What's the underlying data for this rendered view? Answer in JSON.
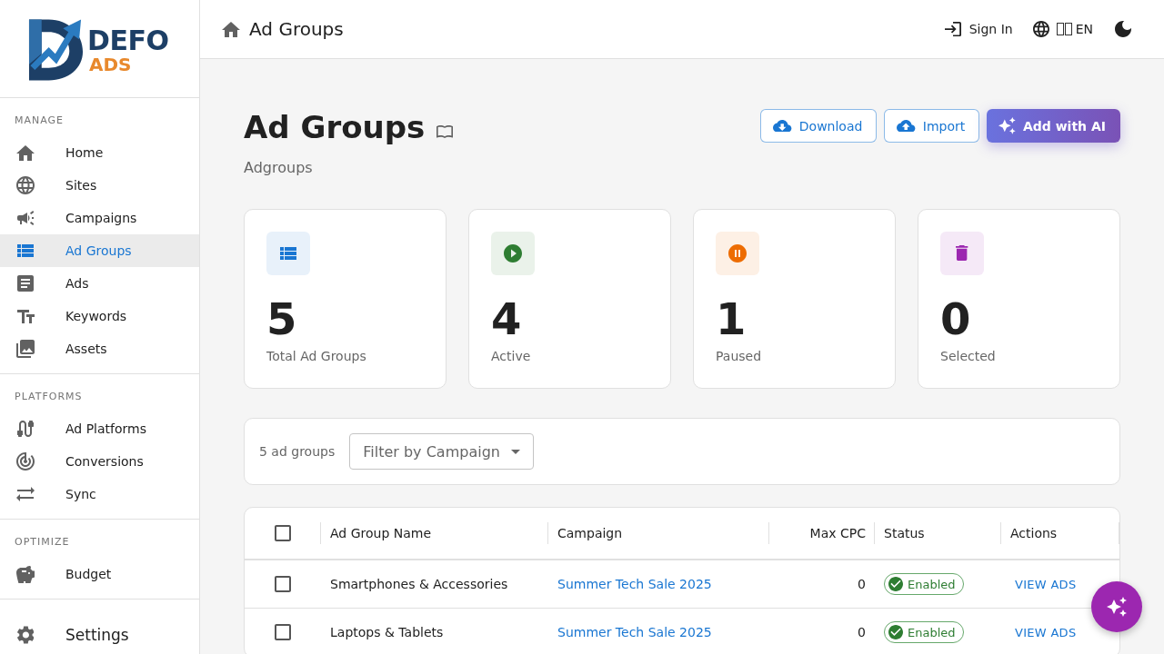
{
  "sidebar": {
    "logo": {
      "name": "DEFO",
      "tagline": "ADS"
    },
    "sections": [
      {
        "label": "MANAGE",
        "items": [
          {
            "label": "Home",
            "selected": false
          },
          {
            "label": "Sites",
            "selected": false
          },
          {
            "label": "Campaigns",
            "selected": false
          },
          {
            "label": "Ad Groups",
            "selected": true
          },
          {
            "label": "Ads",
            "selected": false
          },
          {
            "label": "Keywords",
            "selected": false
          },
          {
            "label": "Assets",
            "selected": false
          }
        ]
      },
      {
        "label": "PLATFORMS",
        "items": [
          {
            "label": "Ad Platforms",
            "selected": false
          },
          {
            "label": "Conversions",
            "selected": false
          },
          {
            "label": "Sync",
            "selected": false
          }
        ]
      },
      {
        "label": "OPTIMIZE",
        "items": [
          {
            "label": "Budget",
            "selected": false
          }
        ]
      }
    ],
    "settings": {
      "label": "Settings",
      "selected": false
    }
  },
  "header": {
    "breadcrumb": "Ad Groups",
    "sign_in": "Sign In",
    "language": "EN"
  },
  "page": {
    "title": "Ad Groups",
    "subtitle": "Adgroups",
    "actions": [
      {
        "label": "Download",
        "kind": "download"
      },
      {
        "label": "Import",
        "kind": "import"
      },
      {
        "label": "Add with AI",
        "kind": "ai"
      }
    ]
  },
  "stats": [
    {
      "value": "5",
      "label": "Total Ad Groups",
      "kind": "total",
      "color": "#1976d2"
    },
    {
      "value": "4",
      "label": "Active",
      "kind": "active",
      "color": "#2e7d32"
    },
    {
      "value": "1",
      "label": "Paused",
      "kind": "paused",
      "color": "#ed6c02"
    },
    {
      "value": "0",
      "label": "Selected",
      "kind": "selected",
      "color": "#9c27b0"
    }
  ],
  "filter_bar": {
    "count": "5 ad groups",
    "campaign_filter": {
      "placeholder": "Filter by Campaign"
    }
  },
  "table": {
    "select_all": {
      "checked": false
    },
    "columns": [
      "Ad Group Name",
      "Campaign",
      "Max CPC",
      "Status",
      "Actions"
    ],
    "rows": [
      {
        "checked": false,
        "name": "Smartphones & Accessories",
        "campaign": "Summer Tech Sale 2025",
        "max_cpc": "0",
        "status": {
          "label": "Enabled",
          "kind": "enabled"
        },
        "action": "VIEW ADS"
      },
      {
        "checked": false,
        "name": "Laptops & Tablets",
        "campaign": "Summer Tech Sale 2025",
        "max_cpc": "0",
        "status": {
          "label": "Enabled",
          "kind": "enabled"
        },
        "action": "VIEW ADS"
      }
    ]
  }
}
